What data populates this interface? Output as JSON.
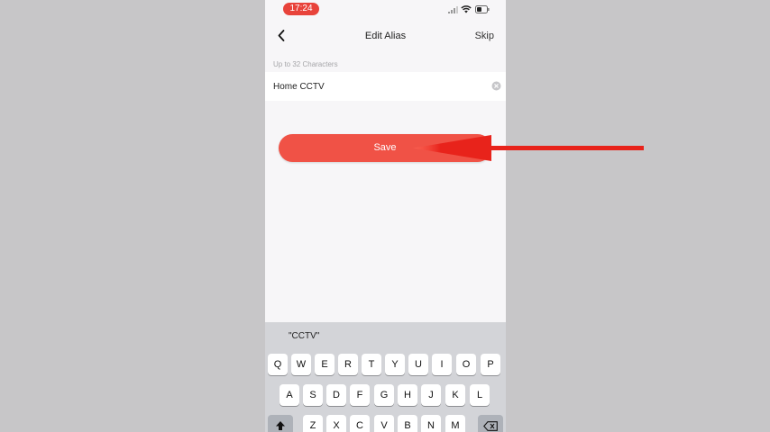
{
  "status_bar": {
    "time": "17:24"
  },
  "nav": {
    "title": "Edit Alias",
    "skip_label": "Skip"
  },
  "form": {
    "hint": "Up to 32 Characters",
    "alias_value": "Home CCTV"
  },
  "save_label": "Save",
  "keyboard": {
    "suggestion": "\"CCTV\"",
    "row1": [
      "Q",
      "W",
      "E",
      "R",
      "T",
      "Y",
      "U",
      "I",
      "O",
      "P"
    ],
    "row2": [
      "A",
      "S",
      "D",
      "F",
      "G",
      "H",
      "J",
      "K",
      "L"
    ],
    "row3": [
      "Z",
      "X",
      "C",
      "V",
      "B",
      "N",
      "M"
    ]
  },
  "colors": {
    "accent": "#f05246",
    "time_pill": "#e8433b",
    "arrow": "#e8231b"
  },
  "icons": [
    "back-icon",
    "signal-icon",
    "wifi-icon",
    "battery-icon",
    "clear-icon",
    "shift-icon",
    "backspace-icon"
  ]
}
